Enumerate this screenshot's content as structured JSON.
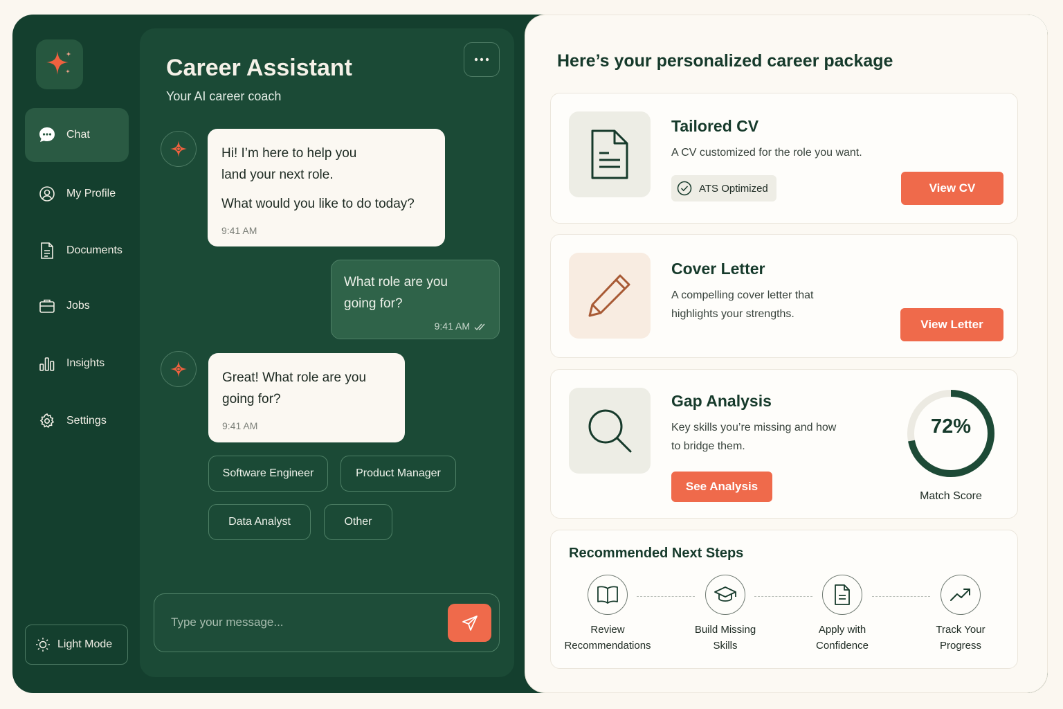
{
  "sidebar": {
    "items": [
      {
        "label": "Chat",
        "icon": "chat-bubble-icon"
      },
      {
        "label": "My Profile",
        "icon": "user-icon"
      },
      {
        "label": "Documents",
        "icon": "document-icon"
      },
      {
        "label": "Jobs",
        "icon": "briefcase-icon"
      },
      {
        "label": "Insights",
        "icon": "bar-chart-icon"
      },
      {
        "label": "Settings",
        "icon": "gear-icon"
      }
    ],
    "light_mode_label": "Light Mode"
  },
  "chat": {
    "title": "Career Assistant",
    "subtitle": "Your AI career coach",
    "messages": [
      {
        "line1": "Hi! I’m here to help you",
        "line2": "land your next role.",
        "line3": "What would you like to do today?",
        "time": "9:41 AM"
      },
      {
        "line1": "What role are you",
        "line2": "going for?",
        "time": "9:41 AM"
      },
      {
        "line1": "Great!  What role are you",
        "line2": "going for?",
        "time": "9:41 AM"
      }
    ],
    "chips": [
      "Software Engineer",
      "Product Manager",
      "Data Analyst",
      "Other"
    ],
    "input_placeholder": "Type your message..."
  },
  "package": {
    "title": "Here’s your personalized career package",
    "cv": {
      "title": "Tailored CV",
      "desc": "A CV customized for the role you want.",
      "badge": "ATS Optimized",
      "button": "View CV"
    },
    "letter": {
      "title": "Cover Letter",
      "desc1": "A compelling cover letter that",
      "desc2": "highlights your strengths.",
      "button": "View Letter"
    },
    "gap": {
      "title": "Gap Analysis",
      "desc1": "Key skills you’re missing and how",
      "desc2": "to bridge them.",
      "button": "See Analysis",
      "score": "72%",
      "score_value": 0.72,
      "score_label": "Match Score"
    },
    "steps": {
      "title": "Recommended Next Steps",
      "items": [
        {
          "l1": "Review",
          "l2": "Recommendations",
          "icon": "book-icon"
        },
        {
          "l1": "Build Missing",
          "l2": "Skills",
          "icon": "graduation-cap-icon"
        },
        {
          "l1": "Apply with",
          "l2": "Confidence",
          "icon": "document-icon"
        },
        {
          "l1": "Track Your",
          "l2": "Progress",
          "icon": "trend-up-icon"
        }
      ]
    }
  },
  "colors": {
    "brand_green": "#143f2e",
    "accent": "#ef6a4b"
  }
}
